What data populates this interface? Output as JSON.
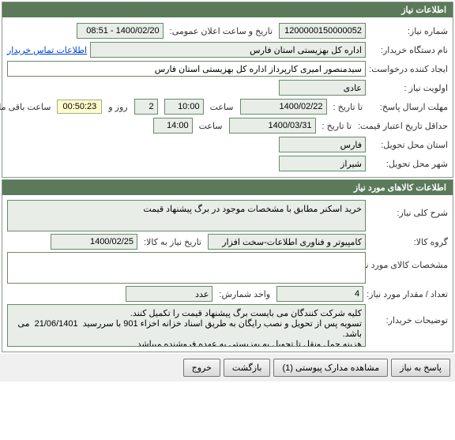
{
  "section1": {
    "title": "اطلاعات نیاز",
    "need_no_label": "شماره نیاز:",
    "need_no": "1200000150000052",
    "public_notice_label": "تاریخ و ساعت اعلان عمومی:",
    "public_notice": "1400/02/20 - 08:51",
    "buyer_org_label": "نام دستگاه خریدار:",
    "buyer_org": "اداره کل بهزیستی استان فارس",
    "contact_link": "اطلاعات تماس خریدار",
    "requester_label": "ایجاد کننده درخواست:",
    "requester": "سیدمنصور امیری کارپرداز اداره کل بهزیستی استان فارس",
    "priority_label": "اولویت نیاز :",
    "priority": "عادی",
    "reply_deadline_label": "مهلت ارسال پاسخ:",
    "until_date_label": "تا تاریخ :",
    "until_date": "1400/02/22",
    "time_label": "ساعت",
    "until_time": "10:00",
    "days": "2",
    "days_label": "روز و",
    "countdown": "00:50:23",
    "remaining_label": "ساعت باقی مانده",
    "min_credit_label": "حداقل تاریخ اعتبار قیمت:",
    "min_credit_until_label": "تا تاریخ :",
    "min_credit_date": "1400/03/31",
    "min_credit_time": "14:00",
    "province_label": "استان محل تحویل:",
    "province": "فارس",
    "city_label": "شهر محل تحویل:",
    "city": "شیراز"
  },
  "section2": {
    "title": "اطلاعات کالاهای مورد نیاز",
    "desc_label": "شرح کلی نیاز:",
    "desc": "خرید اسکنر مطابق با مشخصات موجود در برگ پیشنهاد قیمت",
    "group_label": "گروه کالا:",
    "group": "کامپیوتر و فناوری اطلاعات-سخت افزار",
    "need_until_label": "تاریخ نیاز به کالا:",
    "need_until": "1400/02/25",
    "specs_label": "مشخصات کالای مورد نیاز:",
    "specs": "",
    "qty_label": "تعداد / مقدار مورد نیاز:",
    "qty": "4",
    "unit_label": "واحد شمارش:",
    "unit": "عدد",
    "notes_label": "توضیحات خریدار:",
    "notes": "کلیه شرکت کنندگان می بایست برگ پیشنهاد قیمت را تکمیل کنند.\nتسویه پس از تحویل و نصب رایگان به طریق اسناد خزانه اخزاء 901 با سررسید  21/06/1401  می باشد.\nهزینه حمل ونقل تا تحویل به بهزیستی به عهده فروشنده میباشد"
  },
  "buttons": {
    "reply": "پاسخ به نیاز",
    "view_attach": "مشاهده مدارک پیوستی (1)",
    "back": "بازگشت",
    "exit": "خروج"
  }
}
